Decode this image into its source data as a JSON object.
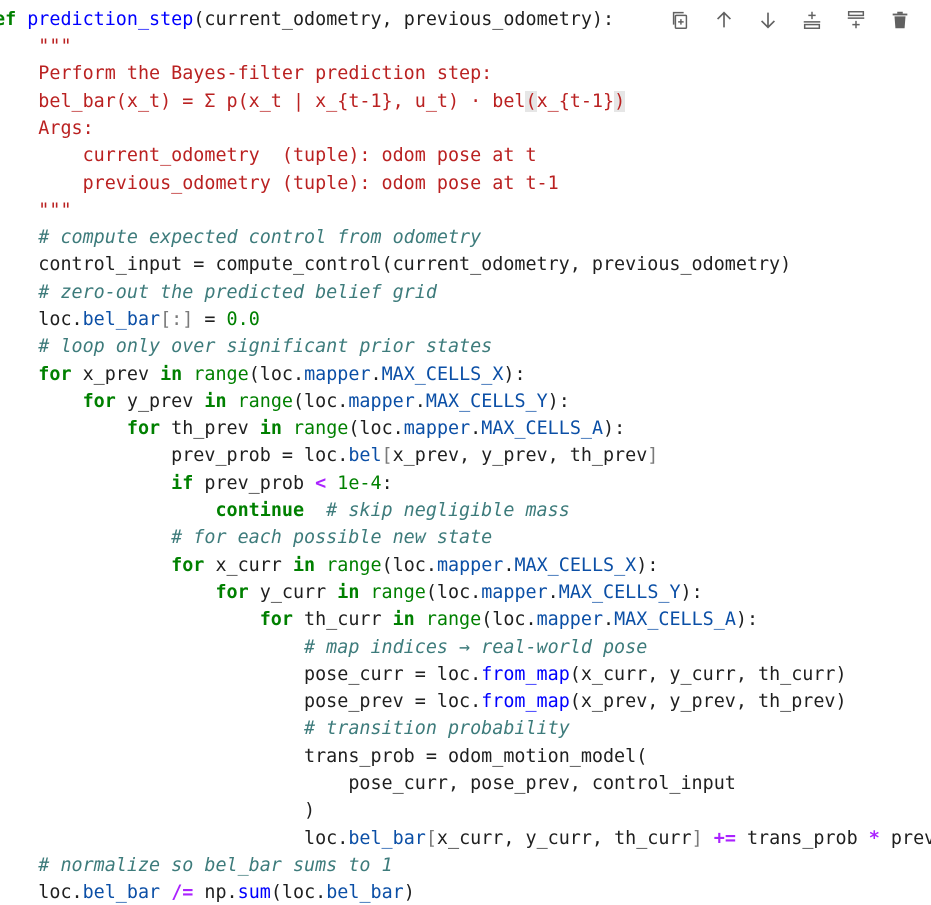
{
  "toolbar": {
    "icons": [
      "duplicate-cell-icon",
      "move-up-icon",
      "move-down-icon",
      "insert-above-icon",
      "insert-below-icon",
      "delete-icon"
    ]
  },
  "code": {
    "l1_kw": "ef",
    "l1_fn": "prediction_step",
    "l1_rest": "(current_odometry, previous_odometry):",
    "l2": "\"\"\"",
    "l3": "Perform the Bayes-filter prediction step:",
    "l4_a": "bel_bar(x_t) = Σ p(x_t | x_{t-1}, u_t) · bel",
    "l4_b": "(",
    "l4_c": "x_{t-1}",
    "l4_d": ")",
    "l5": "Args:",
    "l6": "    current_odometry  (tuple): odom pose at t",
    "l7": "    previous_odometry (tuple): odom pose at t-1",
    "l8": "\"\"\"",
    "l9": "# compute expected control from odometry",
    "l10": "control_input = compute_control(current_odometry, previous_odometry)",
    "l11": "# zero-out the predicted belief grid",
    "l12_a": "loc.",
    "l12_b": "bel_bar",
    "l12_c": "[:]",
    "l12_d": " = ",
    "l12_e": "0.0",
    "l13": "# loop only over significant prior states",
    "kw_for": "for",
    "kw_in": "in",
    "bi_range": "range",
    "attr_mapper": "mapper",
    "l14_var": " x_prev ",
    "l14_attr": "MAX_CELLS_X",
    "l15_var": " y_prev ",
    "l15_attr": "MAX_CELLS_Y",
    "l16_var": " th_prev ",
    "l16_attr": "MAX_CELLS_A",
    "l17_a": "prev_prob = loc.",
    "l17_b": "bel",
    "l17_c": "[",
    "l17_d": "x_prev, y_prev, th_prev",
    "l17_e": "]",
    "l18_kw": "if",
    "l18_a": " prev_prob ",
    "l18_op": "<",
    "l18_num": "1e-4",
    "l18_b": ":",
    "l19_kw": "continue",
    "l19_cm": "  # skip negligible mass",
    "l20": "# for each possible new state",
    "l21_var": " x_curr ",
    "l21_attr": "MAX_CELLS_X",
    "l22_var": " y_curr ",
    "l22_attr": "MAX_CELLS_Y",
    "l23_var": " th_curr ",
    "l23_attr": "MAX_CELLS_A",
    "l24": "# map indices → real-world pose",
    "l25_a": "pose_curr = loc.",
    "l25_fn": "from_map",
    "l25_b": "(x_curr, y_curr, th_curr)",
    "l26_a": "pose_prev = loc.",
    "l26_fn": "from_map",
    "l26_b": "(x_prev, y_prev, th_prev)",
    "l27": "# transition probability",
    "l28": "trans_prob = odom_motion_model(",
    "l29": "    pose_curr, pose_prev, control_input",
    "l30": ")",
    "l31_a": "loc.",
    "l31_b": "bel_bar",
    "l31_c": "[",
    "l31_d": "x_curr, y_curr, th_curr",
    "l31_e": "]",
    "l31_op1": "+=",
    "l31_f": " trans_prob ",
    "l31_op2": "*",
    "l31_g": " prev_pr",
    "l32": "# normalize so bel_bar sums to 1",
    "l33_a": "loc.",
    "l33_b": "bel_bar",
    "l33_op": "/=",
    "l33_c": " np.",
    "l33_fn": "sum",
    "l33_d": "(loc.",
    "l33_e": "bel_bar",
    "l33_f": ")"
  }
}
